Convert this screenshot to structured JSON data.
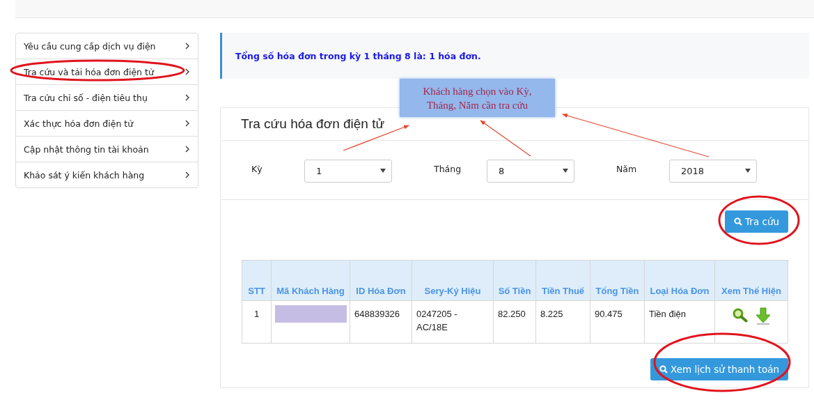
{
  "sidebar": {
    "items": [
      {
        "label": "Yêu cầu cung cấp dịch vụ điện"
      },
      {
        "label": "Tra cứu và tải hóa đơn điện tử"
      },
      {
        "label": "Tra cứu chỉ số - điện tiêu thụ"
      },
      {
        "label": "Xác thực hóa đơn điện tử"
      },
      {
        "label": "Cập nhật thông tin tài khoản"
      },
      {
        "label": "Khảo sát ý kiến khách hàng"
      }
    ]
  },
  "notice": "Tổng số hóa đơn trong kỳ 1 tháng 8 là: 1 hóa đơn.",
  "card": {
    "title": "Tra cứu hóa đơn điện tử",
    "filters": [
      {
        "label": "Kỳ",
        "value": "1"
      },
      {
        "label": "Tháng",
        "value": "8"
      },
      {
        "label": "Năm",
        "value": "2018"
      }
    ],
    "search_button": "Tra cứu",
    "table": {
      "columns": [
        "STT",
        "Mã Khách Hàng",
        "ID Hóa Đơn",
        "Sery-Ký Hiệu",
        "Số Tiền",
        "Tiền Thuế",
        "Tổng Tiền",
        "Loại Hóa Đơn",
        "Xem Thể Hiện"
      ],
      "rows": [
        {
          "cells": [
            "1",
            "",
            "648839326",
            "0247205 - AC/18E",
            "82.250",
            "8.225",
            "90.475",
            "Tiền điện"
          ],
          "redacted": true
        }
      ]
    },
    "history_button": "Xem lịch sử thanh toán"
  },
  "annotation": {
    "callout": "Khách hàng chọn vào Kỳ, Tháng, Năm cần tra cứu"
  }
}
